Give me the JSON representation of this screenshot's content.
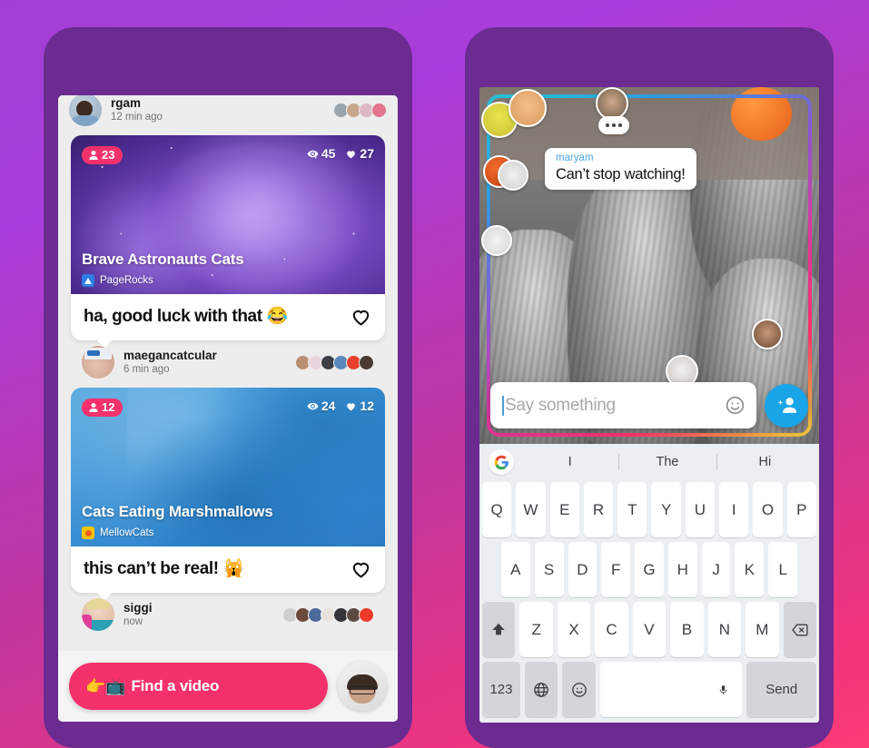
{
  "background": {
    "gradient_from": "#a13fd4",
    "gradient_to": "#fb3a74"
  },
  "theme": {
    "phone_frame": "#6b2b91",
    "accent_pink": "#f5316b",
    "accent_blue": "#19a5e8",
    "link_blue": "#4aa8e8"
  },
  "left_phone": {
    "partial_post": {
      "username": "rgam",
      "time": "12 min ago"
    },
    "posts": [
      {
        "viewer_badge": "23",
        "views": "45",
        "likes": "27",
        "title": "Brave Astronauts Cats",
        "channel": "PageRocks",
        "channel_icon": "triangle-icon",
        "comment": "ha, good luck with that 😂",
        "commenter": "maegancatcular",
        "time": "6 min ago",
        "watcher_count": 6
      },
      {
        "viewer_badge": "12",
        "views": "24",
        "likes": "12",
        "title": "Cats Eating Marshmallows",
        "channel": "MellowCats",
        "channel_icon": "circle-icon",
        "comment": "this can’t be real! 🙀",
        "commenter": "siggi",
        "time": "now",
        "watcher_count": 7
      }
    ],
    "bottom_bar": {
      "find_video_label": "Find a video",
      "find_video_emoji": "👉📺",
      "avatar_name": "my-avatar"
    }
  },
  "right_phone": {
    "chat_bubble": {
      "username": "maryam",
      "message": "Can’t stop watching!"
    },
    "input": {
      "placeholder": "Say something",
      "emoji_icon": "emoji-smiley-icon"
    },
    "fab": {
      "icon": "add-person-icon"
    },
    "keyboard": {
      "suggestions": [
        "I",
        "The",
        "Hi"
      ],
      "logo": "google-g-icon",
      "row1": [
        "Q",
        "W",
        "E",
        "R",
        "T",
        "Y",
        "U",
        "I",
        "O",
        "P"
      ],
      "row2": [
        "A",
        "S",
        "D",
        "F",
        "G",
        "H",
        "J",
        "K",
        "L"
      ],
      "row3": [
        "Z",
        "X",
        "C",
        "V",
        "B",
        "N",
        "M"
      ],
      "shift_icon": "shift-icon",
      "backspace_icon": "backspace-icon",
      "num_label": "123",
      "globe_icon": "globe-icon",
      "emoji_icon": "emoji-icon",
      "mic_icon": "microphone-icon",
      "send_label": "Send"
    }
  }
}
